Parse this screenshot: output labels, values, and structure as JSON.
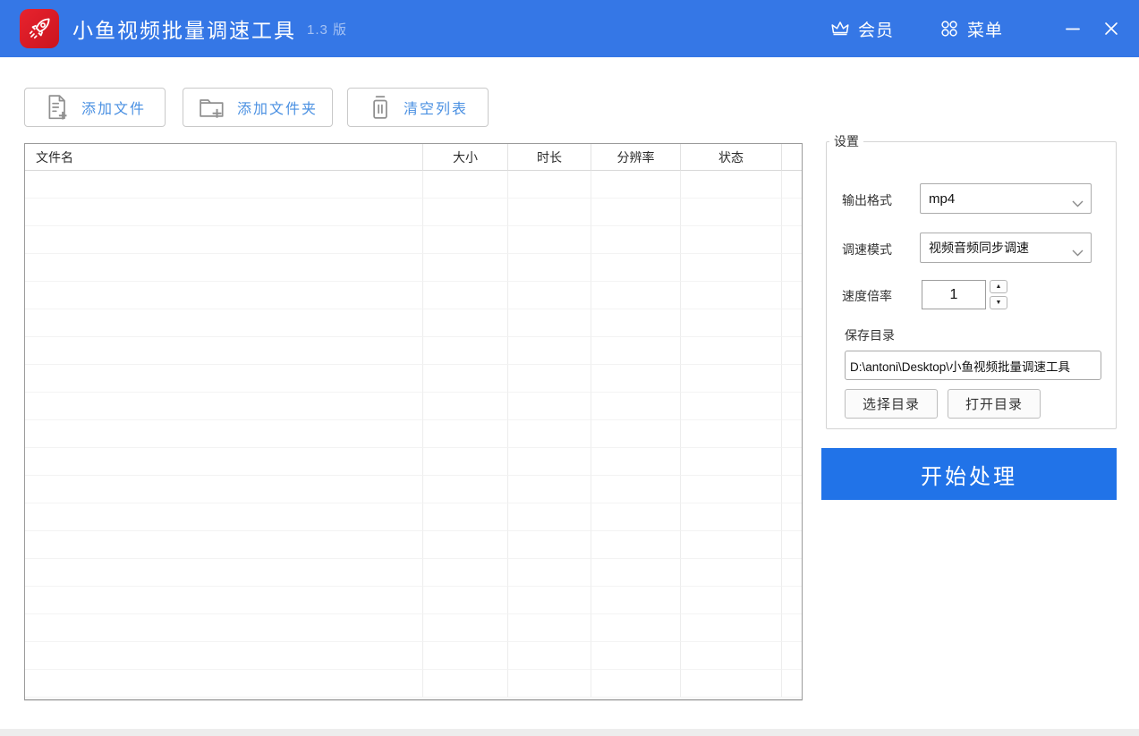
{
  "window": {
    "title": "小鱼视频批量调速工具",
    "version": "1.3 版"
  },
  "titlebar": {
    "member_label": "会员",
    "menu_label": "菜单"
  },
  "toolbar": {
    "add_file_label": "添加文件",
    "add_folder_label": "添加文件夹",
    "clear_list_label": "清空列表"
  },
  "file_table": {
    "columns": [
      "文件名",
      "大小",
      "时长",
      "分辨率",
      "状态"
    ],
    "rows": []
  },
  "settings": {
    "legend": "设置",
    "output_format_label": "输出格式",
    "output_format_value": "mp4",
    "speed_mode_label": "调速模式",
    "speed_mode_value": "视频音频同步调速",
    "speed_rate_label": "速度倍率",
    "speed_rate_value": "1",
    "save_dir_label": "保存目录",
    "save_dir_value": "D:\\antoni\\Desktop\\小鱼视频批量调速工具",
    "choose_dir_label": "选择目录",
    "open_dir_label": "打开目录"
  },
  "actions": {
    "start_label": "开始处理"
  },
  "colors": {
    "titlebar_blue": "#3577e6",
    "start_button_blue": "#2173e8",
    "toolbar_text_blue": "#4a90e2",
    "app_icon_red": "#d81e28"
  }
}
